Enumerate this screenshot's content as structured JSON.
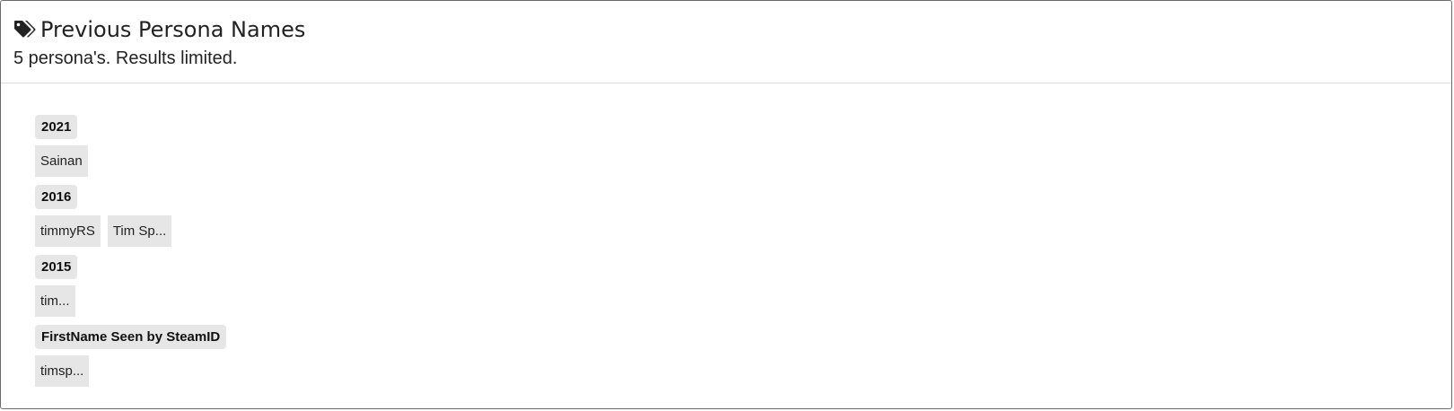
{
  "header": {
    "title": "Previous Persona Names",
    "subtitle": "5 persona's. Results limited."
  },
  "icons": {
    "title_icon": "tags-icon"
  },
  "colors": {
    "chip_background": "#e6e6e6",
    "border": "#6b6b6b",
    "divider": "#dcdcdc"
  },
  "groups": [
    {
      "label": "2021",
      "names": [
        "Sainan"
      ]
    },
    {
      "label": "2016",
      "names": [
        "timmyRS",
        "Tim Sp..."
      ]
    },
    {
      "label": "2015",
      "names": [
        "tim..."
      ]
    },
    {
      "label": "FirstName Seen by SteamID",
      "names": [
        "timsp..."
      ]
    }
  ]
}
